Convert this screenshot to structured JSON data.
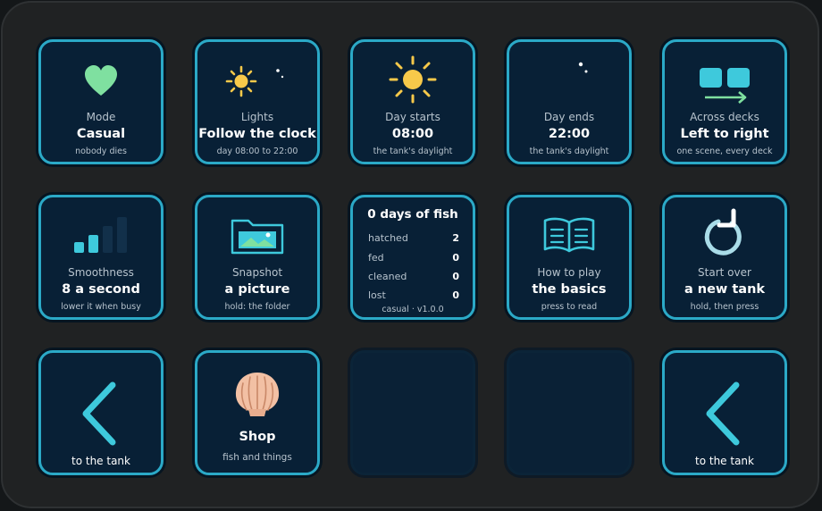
{
  "keys": {
    "mode": {
      "label": "Mode",
      "value": "Casual",
      "sub": "nobody dies",
      "icon": "heart-icon"
    },
    "lights": {
      "label": "Lights",
      "value": "Follow the clock",
      "sub": "day 08:00 to 22:00",
      "icon": "sun-moon-icon"
    },
    "day_starts": {
      "label": "Day starts",
      "value": "08:00",
      "sub": "the tank's daylight",
      "icon": "sun-icon"
    },
    "day_ends": {
      "label": "Day ends",
      "value": "22:00",
      "sub": "the tank's daylight",
      "icon": "moon-icon"
    },
    "across_decks": {
      "label": "Across decks",
      "value": "Left to right",
      "sub": "one scene, every deck",
      "icon": "decks-arrow-icon"
    },
    "smoothness": {
      "label": "Smoothness",
      "value": "8 a second",
      "sub": "lower it when busy",
      "icon": "signal-bars-icon"
    },
    "snapshot": {
      "label": "Snapshot",
      "value": "a picture",
      "sub": "hold: the folder",
      "icon": "folder-image-icon"
    },
    "stats": {
      "title": "0 days of fish",
      "rows": [
        {
          "key": "hatched",
          "value": "2"
        },
        {
          "key": "fed",
          "value": "0"
        },
        {
          "key": "cleaned",
          "value": "0"
        },
        {
          "key": "lost",
          "value": "0"
        }
      ],
      "footer": "casual · v1.0.0"
    },
    "how_to_play": {
      "label": "How to play",
      "value": "the basics",
      "sub": "press to read",
      "icon": "book-icon"
    },
    "start_over": {
      "label": "Start over",
      "value": "a new tank",
      "sub": "hold, then press",
      "icon": "restart-icon"
    },
    "back_left": {
      "label": "to the tank",
      "icon": "chevron-left-icon"
    },
    "shop": {
      "value": "Shop",
      "sub": "fish and things",
      "icon": "shell-icon"
    },
    "back_right": {
      "label": "to the tank",
      "icon": "chevron-left-icon"
    }
  },
  "colors": {
    "key_border": "#2ba9c7",
    "key_bg": "#082036",
    "accent_cyan": "#3ec9dc",
    "accent_green": "#7fe0a0",
    "sun_yellow": "#f7c94a"
  }
}
